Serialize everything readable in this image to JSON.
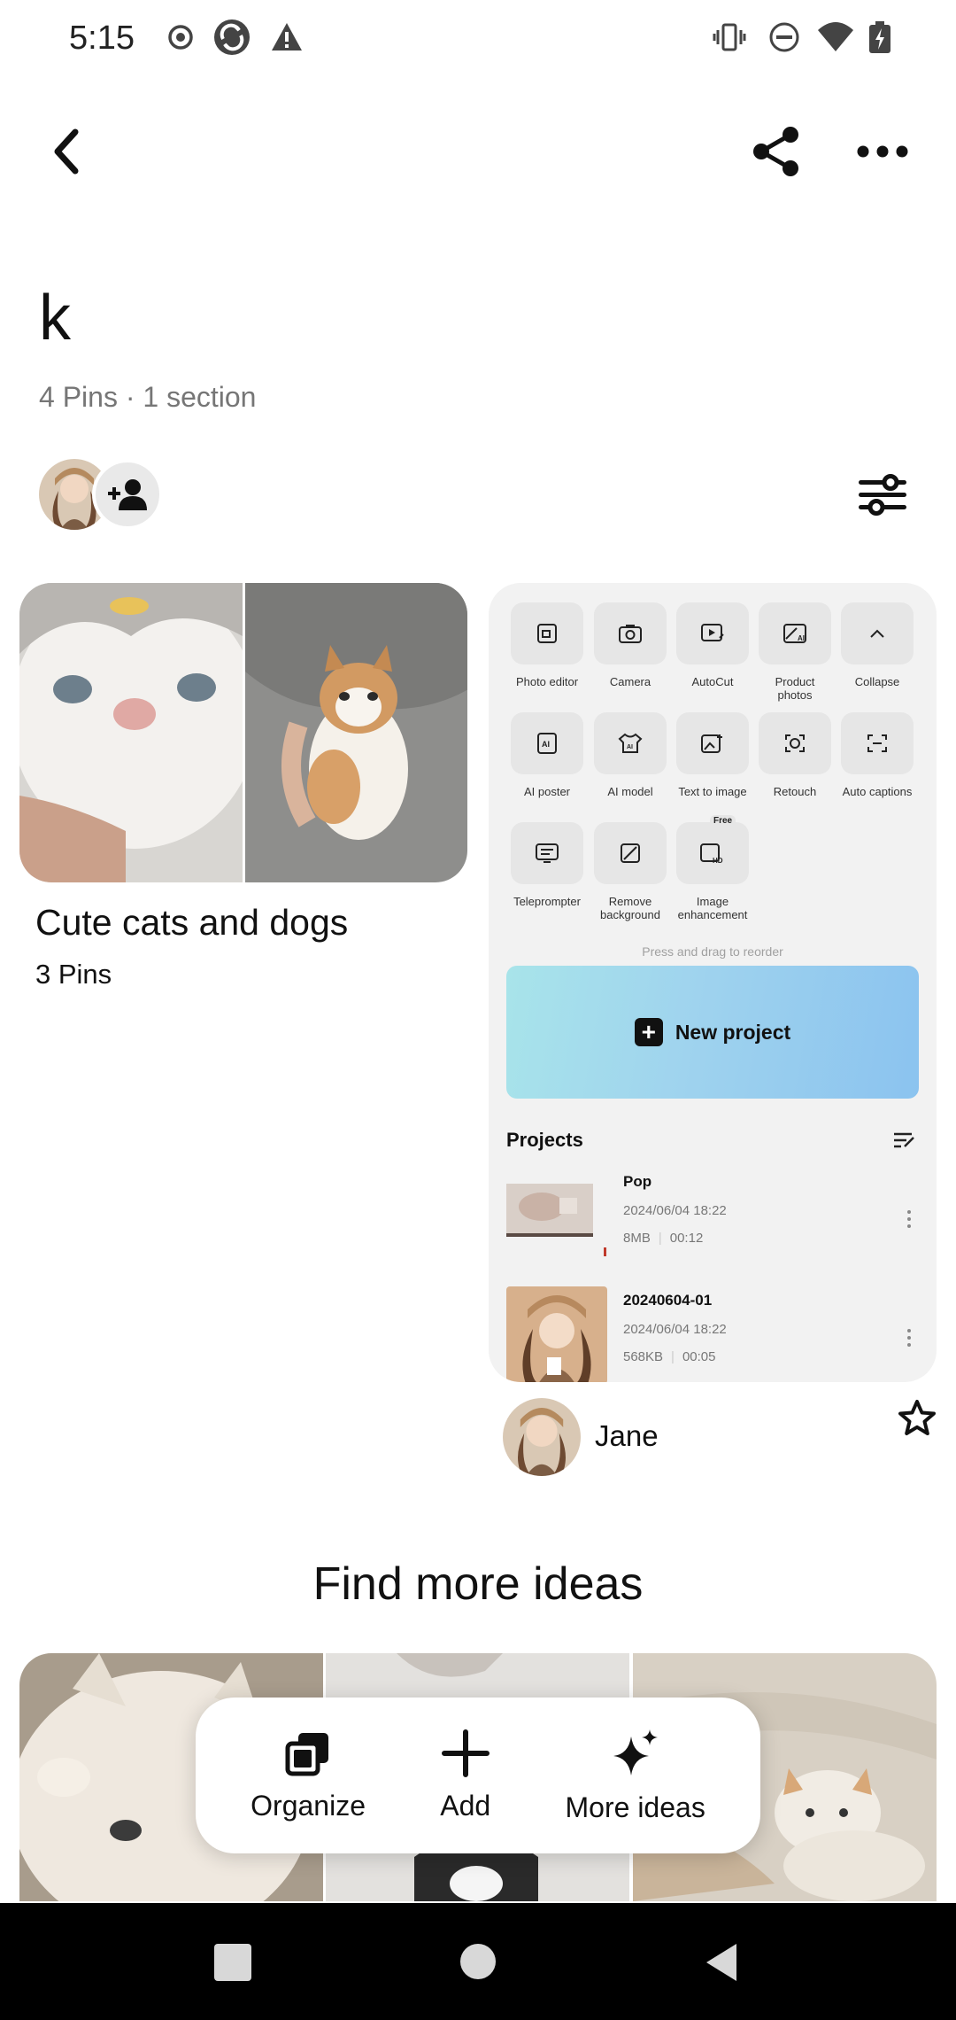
{
  "status_bar": {
    "time": "5:15"
  },
  "board": {
    "title": "k",
    "meta": "4 Pins · 1 section"
  },
  "section": {
    "title": "Cute cats and dogs",
    "count": "3 Pins"
  },
  "pin": {
    "tools": [
      {
        "label": "Photo editor"
      },
      {
        "label": "Camera"
      },
      {
        "label": "AutoCut"
      },
      {
        "label": "Product photos"
      },
      {
        "label": "Collapse"
      },
      {
        "label": "AI poster"
      },
      {
        "label": "AI model"
      },
      {
        "label": "Text to image"
      },
      {
        "label": "Retouch"
      },
      {
        "label": "Auto captions"
      },
      {
        "label": "Teleprompter"
      },
      {
        "label": "Remove background"
      },
      {
        "label": "Image enhancement"
      }
    ],
    "free_badge": "Free",
    "hint": "Press and drag to reorder",
    "new_project": "New project",
    "projects_heading": "Projects",
    "projects": [
      {
        "name": "Pop",
        "date": "2024/06/04 18:22",
        "size": "8MB",
        "duration": "00:12"
      },
      {
        "name": "20240604-01",
        "date": "2024/06/04 18:22",
        "size": "568KB",
        "duration": "00:05"
      }
    ],
    "author": "Jane"
  },
  "find_more": "Find more ideas",
  "actions": {
    "organize": "Organize",
    "add": "Add",
    "more_ideas": "More ideas"
  }
}
